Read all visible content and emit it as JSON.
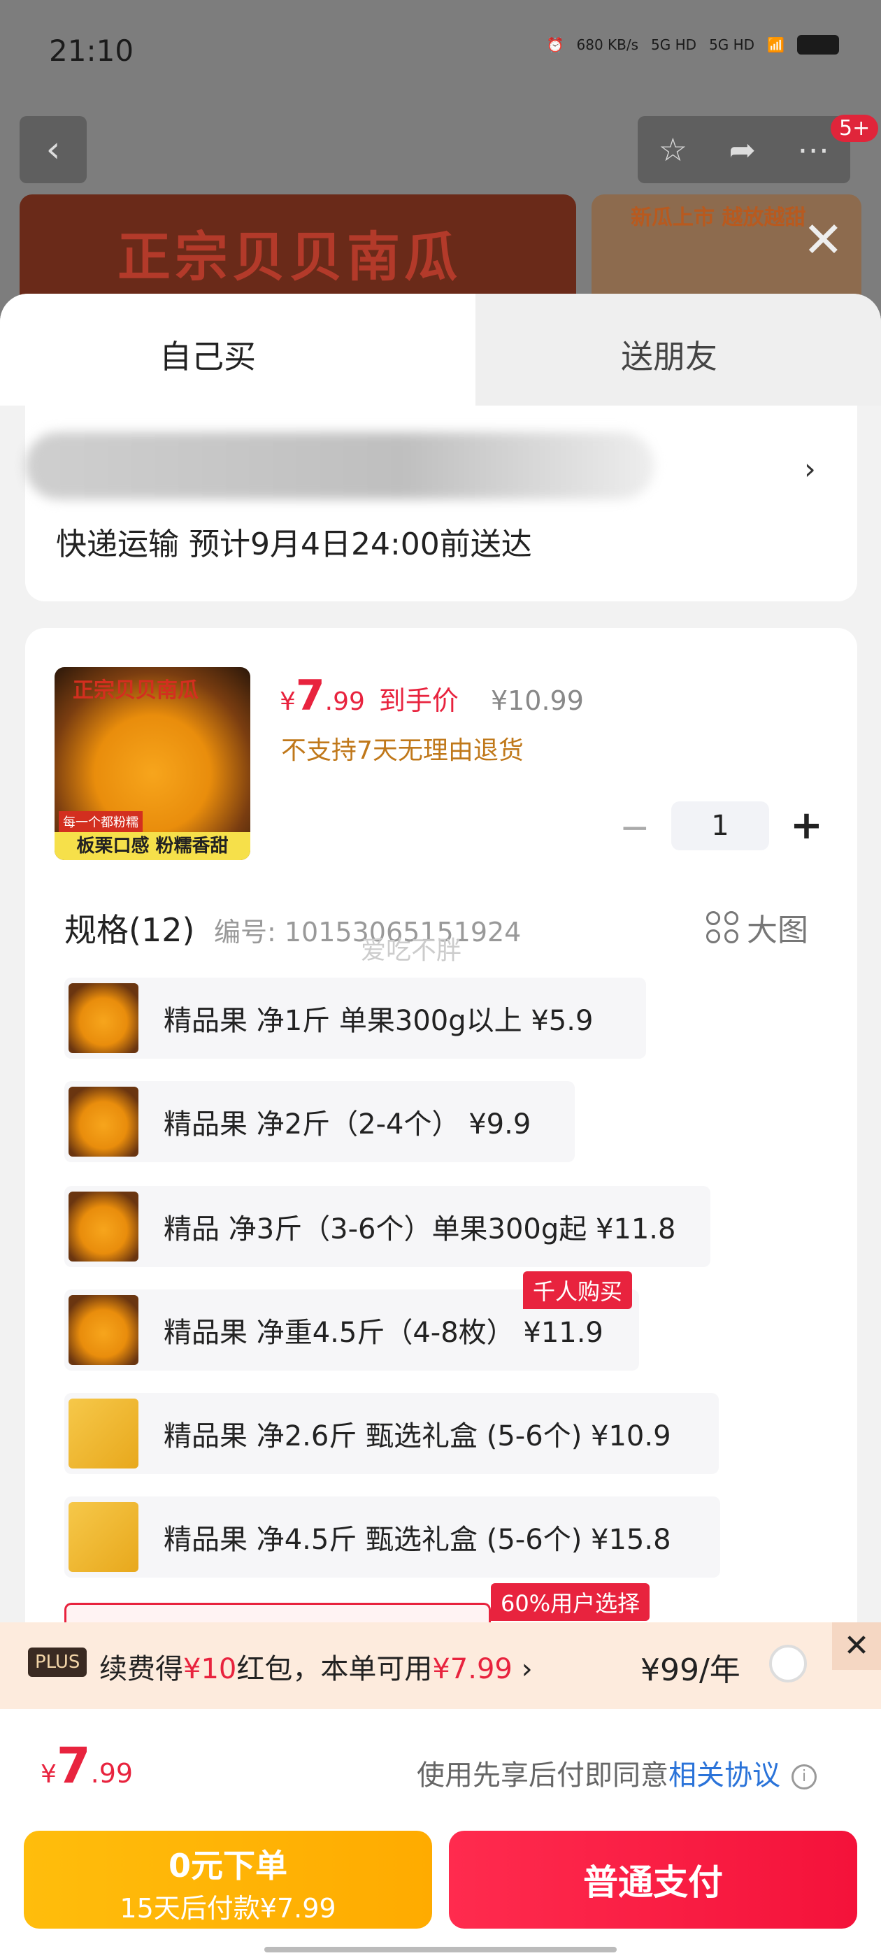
{
  "status_bar": {
    "time": "21:10",
    "net_speed": "680 KB/s",
    "signal1": "5G HD",
    "signal2": "5G HD"
  },
  "nav": {
    "back_icon": "chevron-left-icon",
    "notif_count": "5+"
  },
  "banner": {
    "left_text": "正宗贝贝南瓜",
    "right_text": "新瓜上市 越放越甜"
  },
  "tabs": {
    "self": "自己买",
    "friend": "送朋友"
  },
  "address": {
    "delivery": "快递运输 预计9月4日24:00前送达"
  },
  "product": {
    "image_title": "正宗贝贝南瓜",
    "image_tag": "每一个都粉糯",
    "image_bottom": "板栗口感 粉糯香甜",
    "price_yen": "¥",
    "price_int": "7",
    "price_dec": ".99",
    "price_label": "到手价",
    "orig_price": "¥10.99",
    "no_return": "不支持7天无理由退货",
    "qty_minus": "−",
    "quantity": "1",
    "qty_plus": "+"
  },
  "specs": {
    "title": "规格(12)",
    "code": "编号: 10153065151924",
    "watermark": "爱吃不胖",
    "big_image": "大图",
    "items": [
      {
        "label": "精品果 净1斤 单果300g以上  ¥5.9"
      },
      {
        "label": "精品果 净2斤（2-4个） ¥9.9"
      },
      {
        "label": "精品 净3斤（3-6个）单果300g起  ¥11.8"
      },
      {
        "label": "精品果 净重4.5斤（4-8枚） ¥11.9",
        "badge": "千人购买"
      },
      {
        "label": "精品果 净2.6斤 甄选礼盒 (5-6个)  ¥10.9"
      },
      {
        "label": "精品果 净4.5斤 甄选礼盒 (5-6个)  ¥15.8"
      }
    ],
    "next_badge": "60%用户选择"
  },
  "plus": {
    "tag": "PLUS",
    "text_a": "续费得",
    "text_b": "¥10",
    "text_c": "红包，本单可用",
    "text_d": "¥7.99",
    "text_e": " ›",
    "price": "¥99/年",
    "close": "✕"
  },
  "total": {
    "yen": "¥",
    "int": "7",
    "dec": ".99",
    "agree_text": "使用先享后付即同意",
    "agree_link": "相关协议",
    "info": "i"
  },
  "buttons": {
    "later_line1": "0元下单",
    "later_line2": "15天后付款¥7.99",
    "pay": "普通支付"
  },
  "colors": {
    "accent": "#e8233e",
    "pay_later": "#ffb300",
    "link": "#2a73d9"
  }
}
